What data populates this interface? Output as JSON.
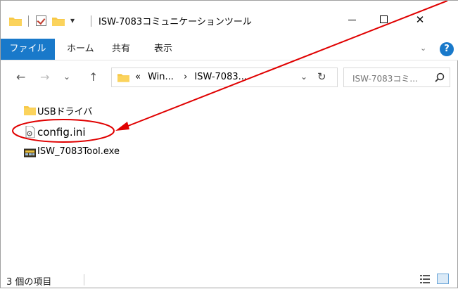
{
  "window": {
    "title": "ISW-7083コミュニケーションツール",
    "qat_dropdown": "▾",
    "controls": {
      "minimize": "",
      "maximize": "",
      "close": "✕"
    }
  },
  "ribbon": {
    "tabs": [
      {
        "label": "ファイル",
        "active": true
      },
      {
        "label": "ホーム"
      },
      {
        "label": "共有"
      },
      {
        "label": "表示"
      }
    ],
    "expand_icon": "⌄",
    "help_label": "?"
  },
  "navigation": {
    "back": "←",
    "forward": "→",
    "recent": "⌄",
    "up": "↑",
    "address": {
      "overflow": "«",
      "crumbs": [
        "Win...",
        "ISW-7083..."
      ],
      "separator": "›",
      "dropdown": "⌄",
      "refresh": "↻"
    },
    "search_placeholder": "ISW-7083コミ..."
  },
  "files": [
    {
      "name": "USBドライバ",
      "type": "folder"
    },
    {
      "name": "config.ini",
      "type": "settings"
    },
    {
      "name": "ISW_7083Tool.exe",
      "type": "exe"
    }
  ],
  "status": {
    "item_count": "3 個の項目"
  },
  "colors": {
    "accent": "#1979ca",
    "folder": "#f7c948",
    "annotation": "#e00000"
  }
}
